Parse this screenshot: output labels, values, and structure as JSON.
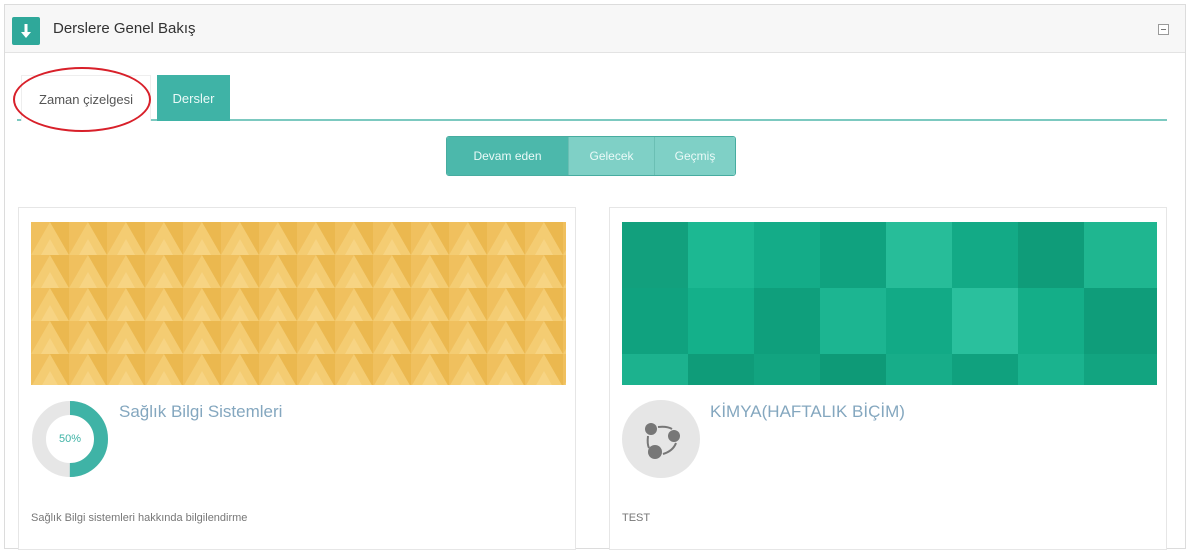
{
  "block": {
    "title": "Derslere Genel Bakış",
    "icon": "download-icon",
    "collapse_icon": "collapse-icon"
  },
  "tabs": [
    {
      "label": "Zaman çizelgesi",
      "active": false
    },
    {
      "label": "Dersler",
      "active": true
    }
  ],
  "annotation": {
    "color": "#d8202a"
  },
  "filters": [
    {
      "label": "Devam eden",
      "active": true
    },
    {
      "label": "Gelecek",
      "active": false
    },
    {
      "label": "Geçmiş",
      "active": false
    }
  ],
  "courses": [
    {
      "title": "Sağlık Bilgi Sistemleri",
      "progress_label": "50%",
      "progress": 0.5,
      "description": "Sağlık Bilgi sistemleri hakkında bilgilendirme",
      "image_color": "#f0c05e"
    },
    {
      "title": "KİMYA(HAFTALIK BİÇİM)",
      "icon": "course-share-icon",
      "description": "TEST",
      "image_color": "#16a985"
    }
  ],
  "colors": {
    "accent": "#3fb3a6",
    "tab_line": "#7cc9c0",
    "title_link": "#84a7bf"
  }
}
